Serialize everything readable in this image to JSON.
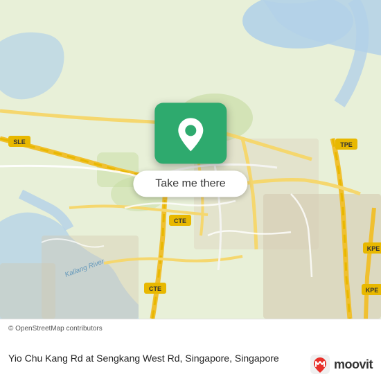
{
  "map": {
    "alt": "OpenStreetMap of Singapore Yio Chu Kang area"
  },
  "overlay": {
    "button_label": "Take me there"
  },
  "footer": {
    "attribution": "© OpenStreetMap contributors",
    "address": "Yio Chu Kang Rd at Sengkang West Rd, Singapore, Singapore"
  },
  "branding": {
    "name": "moovit"
  },
  "colors": {
    "green": "#2eaa6e",
    "white": "#ffffff",
    "road_yellow": "#f5d76e",
    "expressway_yellow": "#e8c84a",
    "water": "#b3d1e8",
    "land": "#e8f0d8",
    "urban": "#d4c9b0"
  }
}
